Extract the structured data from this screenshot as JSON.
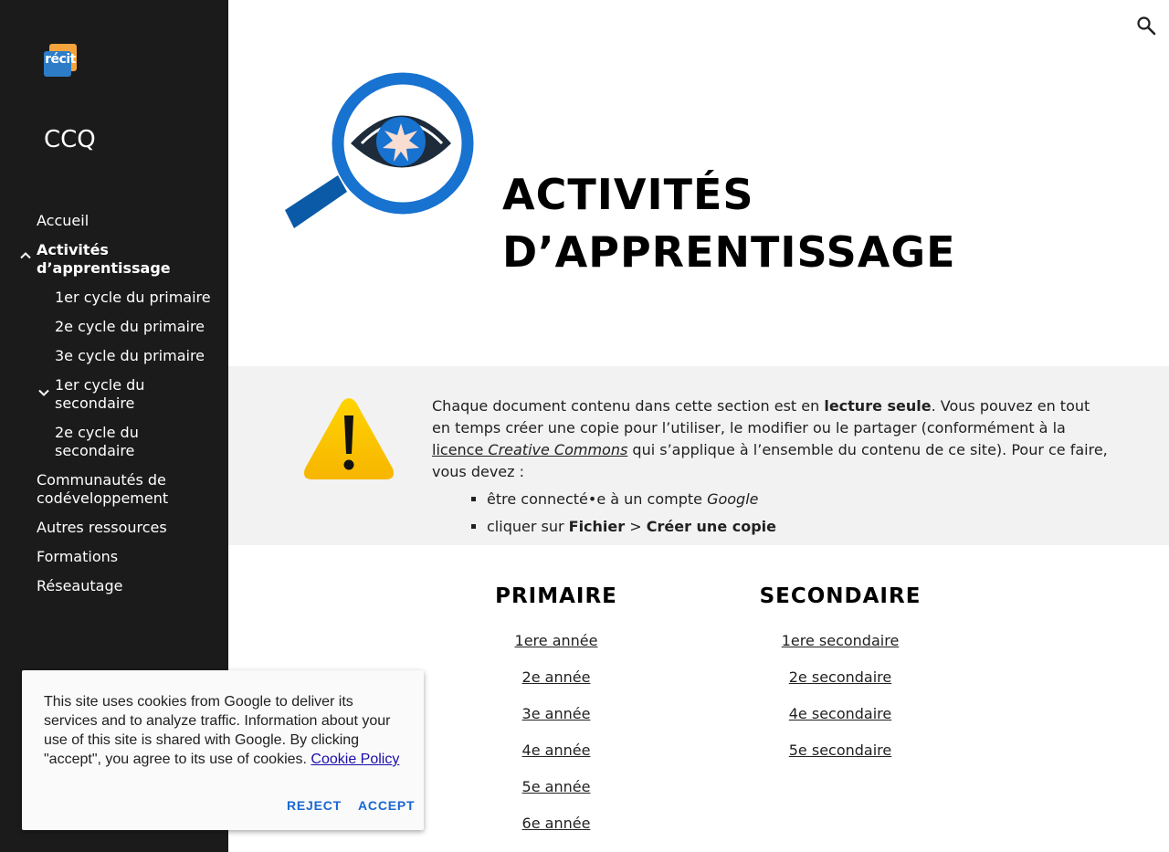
{
  "sidebar": {
    "logo_text": "récit",
    "site_title": "CCQ",
    "items": [
      {
        "label": "Accueil"
      },
      {
        "label": "Activités d’apprentissage"
      },
      {
        "label": "1er cycle du primaire"
      },
      {
        "label": "2e cycle du primaire"
      },
      {
        "label": "3e cycle du primaire"
      },
      {
        "label": "1er cycle du secondaire"
      },
      {
        "label": "2e cycle du secondaire"
      },
      {
        "label": "Communautés de codéveloppement"
      },
      {
        "label": "Autres ressources"
      },
      {
        "label": "Formations"
      },
      {
        "label": "Réseautage"
      }
    ],
    "icons": {
      "expanded": "chevron-up-icon",
      "collapsed": "chevron-down-icon"
    }
  },
  "header": {
    "search_icon": "search-icon"
  },
  "hero": {
    "title_line1": "ACTIVITÉS",
    "title_line2": "D’APPRENTISSAGE",
    "image": "magnifying-glass-eye-icon"
  },
  "notice": {
    "icon": "warning-icon",
    "p1_a": "Chaque document contenu dans cette section est en ",
    "p1_b": "lecture seule",
    "p1_c": ". Vous pouvez en tout en temps créer une copie pour l’utiliser, le modifier ou le partager (conformément à la ",
    "p1_link_a": "licence ",
    "p1_link_b": "Creative Commons",
    "p1_d": " qui s’applique à l’ensemble du contenu de ce site). Pour ce faire, vous devez :",
    "li1_a": "être connecté•e à un compte ",
    "li1_b": "Google",
    "li2_a": "cliquer sur ",
    "li2_b": "Fichier",
    "li2_c": " > ",
    "li2_d": "Créer une copie"
  },
  "primaire": {
    "heading": "PRIMAIRE",
    "links": [
      "1ere année",
      "2e année",
      "3e année",
      "4e année",
      "5e année",
      "6e année"
    ]
  },
  "secondaire": {
    "heading": "SECONDAIRE",
    "links": [
      "1ere secondaire",
      "2e secondaire",
      "4e secondaire",
      "5e secondaire"
    ]
  },
  "cookie": {
    "text": "This site uses cookies from Google to deliver its services and to analyze traffic. Information about your use of this site is shared with Google. By clicking \"accept\", you agree to its use of cookies. ",
    "policy_link": "Cookie Policy",
    "reject": "REJECT",
    "accept": "ACCEPT"
  },
  "colors": {
    "sidebar_bg": "#1b1b1b",
    "notice_bg": "#f2f2f2",
    "accent_blue": "#1a73e8",
    "cookie_button": "#1967d2"
  }
}
